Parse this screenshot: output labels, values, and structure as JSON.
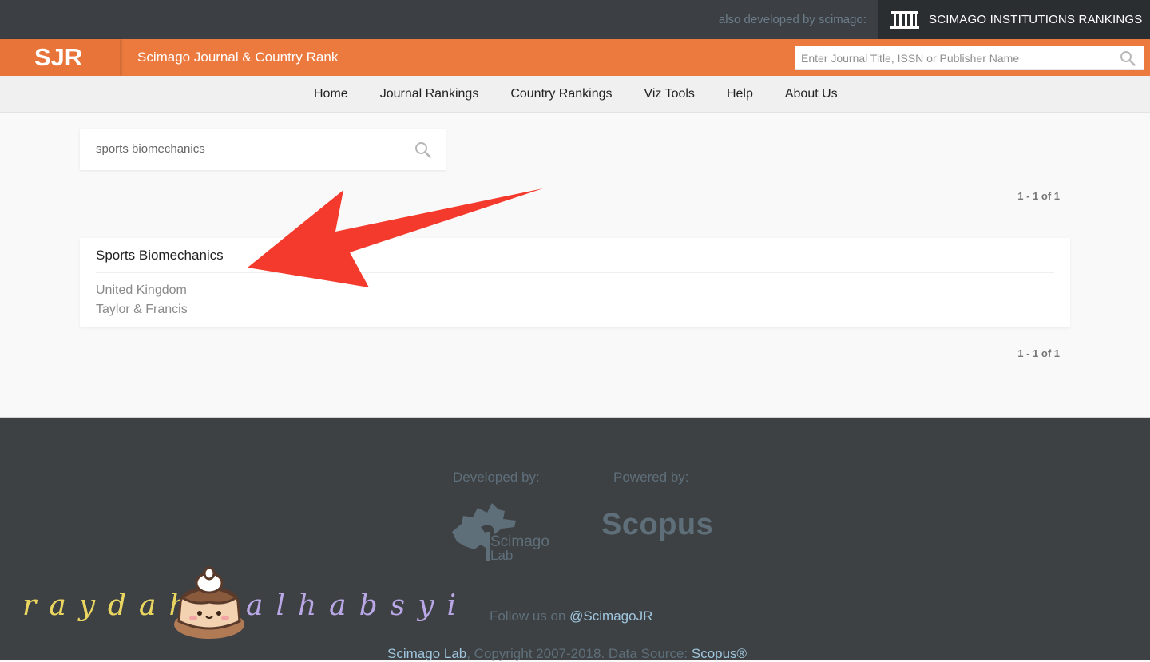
{
  "topbar": {
    "also_text": "also developed by scimago:",
    "sir_label": "SCIMAGO INSTITUTIONS RANKINGS",
    "sir_icon": "institution-columns-icon"
  },
  "header": {
    "logo": "SJR",
    "site_title": "Scimago Journal & Country Rank",
    "search_placeholder": "Enter Journal Title, ISSN or Publisher Name",
    "search_icon": "search-icon"
  },
  "nav": {
    "items": [
      "Home",
      "Journal Rankings",
      "Country Rankings",
      "Viz Tools",
      "Help",
      "About Us"
    ]
  },
  "search": {
    "value": "sports biomechanics"
  },
  "pager": {
    "top": "1 - 1 of 1",
    "bottom": "1 - 1 of 1"
  },
  "results": [
    {
      "title": "Sports Biomechanics",
      "country": "United Kingdom",
      "publisher": "Taylor & Francis"
    }
  ],
  "footer": {
    "developed_by": "Developed by:",
    "powered_by": "Powered by:",
    "scimago_logo_text": "Scimago",
    "scimago_logo_sub": "Lab",
    "scopus_logo": "Scopus",
    "follow_prefix": "Follow us on ",
    "follow_handle": "@ScimagoJR",
    "copy_link": "Scimago Lab",
    "copy_text": ", Copyright 2007-2018. Data Source: ",
    "copy_source": "Scopus®"
  },
  "watermark": {
    "left": "raydah",
    "right": "alhabsyi"
  },
  "colors": {
    "orange": "#ec7a3f",
    "dark": "#3c4044",
    "arrow": "#f43a2c"
  }
}
